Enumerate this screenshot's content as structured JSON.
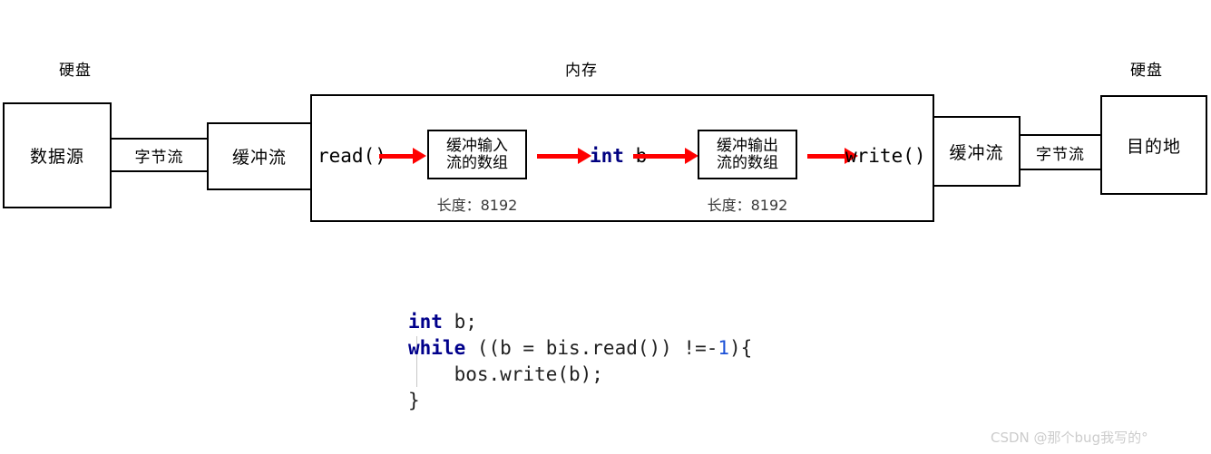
{
  "diagram": {
    "title_labels": {
      "disk_left": "硬盘",
      "memory": "内存",
      "disk_right": "硬盘"
    },
    "left_chain": {
      "source_box": "数据源",
      "byte_stream_band": "字节流",
      "buffer_stream_box": "缓冲流"
    },
    "memory": {
      "read_call": "read()",
      "input_buffer_array": {
        "line1": "缓冲输入",
        "line2": "流的数组",
        "length_label": "长度：8192"
      },
      "variable": {
        "keyword": "int",
        "name": "b"
      },
      "output_buffer_array": {
        "line1": "缓冲输出",
        "line2": "流的数组",
        "length_label": "长度：8192"
      },
      "write_call": "write()"
    },
    "right_chain": {
      "buffer_stream_box": "缓冲流",
      "byte_stream_band": "字节流",
      "destination_box": "目的地"
    },
    "colors": {
      "arrow": "#ff0000",
      "keyword": "#000080",
      "stroke": "#000000"
    }
  },
  "code": {
    "line1": {
      "keyword": "int",
      "rest": " b;"
    },
    "line2": {
      "keyword": "while",
      "mid": " ((b = bis.read()) !=-",
      "number": "1",
      "tail": "){"
    },
    "line3": "    bos.write(b);",
    "line4": "}"
  },
  "watermark": {
    "text": "CSDN @那个bug我写的°"
  }
}
